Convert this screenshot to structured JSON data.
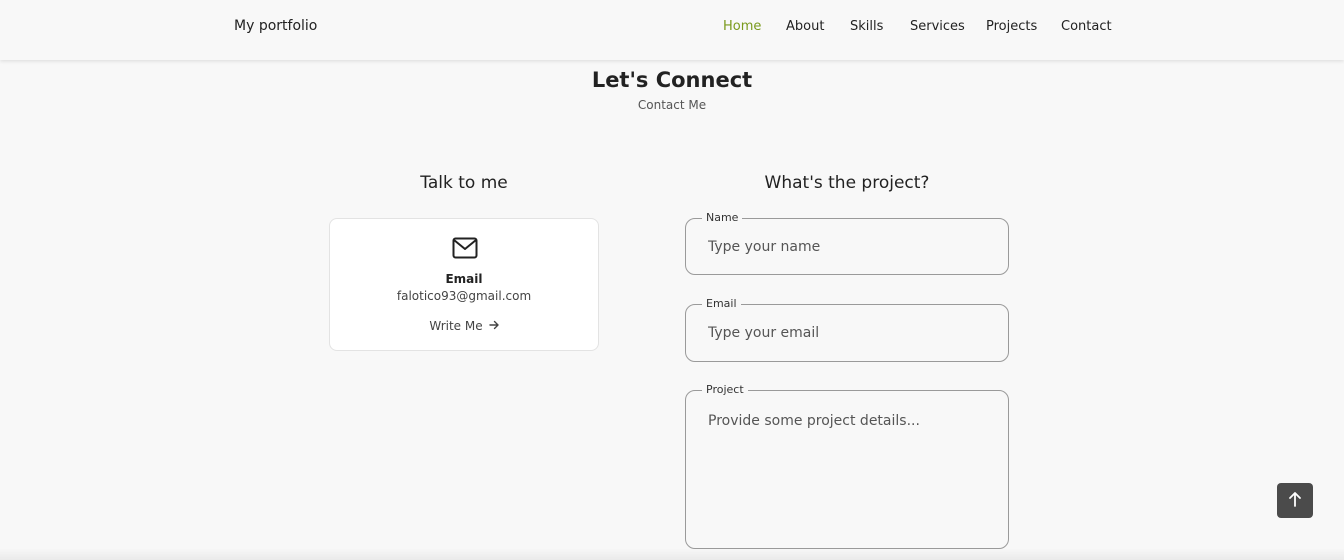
{
  "header": {
    "logo": "My portfolio",
    "nav": [
      "Home",
      "About",
      "Skills",
      "Services",
      "Projects",
      "Contact"
    ],
    "active_nav": "Home",
    "active_color": "#7a9a1c"
  },
  "contact": {
    "title": "Let's Connect",
    "subtitle": "Contact Me",
    "talk": {
      "title": "Talk to me",
      "card": {
        "icon": "envelope-icon",
        "title": "Email",
        "data": "falotico93@gmail.com",
        "link_label": "Write Me",
        "link_icon": "arrow-right-icon"
      }
    },
    "form": {
      "title": "What's the project?",
      "name_label": "Name",
      "name_placeholder": "Type your name",
      "email_label": "Email",
      "email_placeholder": "Type your email",
      "project_label": "Project",
      "project_placeholder": "Provide some project details..."
    }
  },
  "scroll_up": {
    "icon": "arrow-up-icon"
  }
}
